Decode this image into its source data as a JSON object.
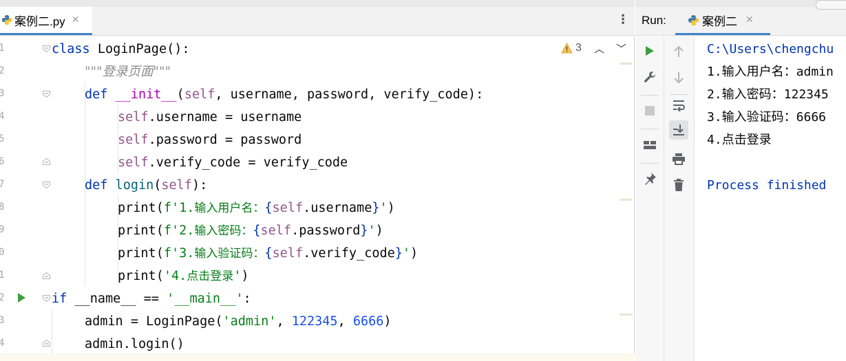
{
  "editor": {
    "tab_label": "案例二.py",
    "tab_close": "✕",
    "menu_icon": "⋮",
    "line_numbers": [
      "1",
      "2",
      "3",
      "4",
      "5",
      "6",
      "7",
      "8",
      "9",
      "0",
      "1",
      "2",
      "3",
      "4"
    ],
    "warning_icon": "warning-triangle-icon",
    "warning_count": "3",
    "nav_up": "︿",
    "nav_down": "﹀",
    "code": {
      "l1_kw": "class",
      "l1_name": " LoginPage",
      "l1_rest": "():",
      "l2_doc": "\"\"\"登录页面\"\"\"",
      "l3_def": "def",
      "l3_sp": " ",
      "l3_init": "__init__",
      "l3_p1": "(",
      "l3_self": "self",
      "l3_rest": ", username, password, verify_code):",
      "l4_self": "self",
      "l4_rest": ".username = username",
      "l5_self": "self",
      "l5_rest": ".password = password",
      "l6_self": "self",
      "l6_rest": ".verify_code = verify_code",
      "l7_def": "def",
      "l7_name": " login",
      "l7_p1": "(",
      "l7_self": "self",
      "l7_rest": "):",
      "l8_print": "print(",
      "l8_f": "f'1.",
      "l8_cn": "输入用户名：",
      "l8_b1": "{",
      "l8_self": "self",
      "l8_attr": ".username",
      "l8_b2": "}",
      "l8_q": "'",
      "l8_end": ")",
      "l9_print": "print(",
      "l9_f": "f'2.",
      "l9_cn": "输入密码：",
      "l9_b1": "{",
      "l9_self": "self",
      "l9_attr": ".password",
      "l9_b2": "}",
      "l9_q": "'",
      "l9_end": ")",
      "l10_print": "print(",
      "l10_f": "f'3.",
      "l10_cn": "输入验证码：",
      "l10_b1": "{",
      "l10_self": "self",
      "l10_attr": ".verify_code",
      "l10_b2": "}",
      "l10_q": "'",
      "l10_end": ")",
      "l11_print": "print(",
      "l11_s1": "'4.",
      "l11_cn": "点击登录",
      "l11_s2": "'",
      "l11_end": ")",
      "l12_if": "if",
      "l12_mid": " __name__ == ",
      "l12_str": "'__main__'",
      "l12_end": ":",
      "l13_a": "admin = LoginPage(",
      "l13_s": "'admin'",
      "l13_c1": ", ",
      "l13_n1": "122345",
      "l13_c2": ", ",
      "l13_n2": "6666",
      "l13_end": ")",
      "l14": "admin.login()"
    }
  },
  "run": {
    "title": "Run:",
    "tab_label": "案例二",
    "tab_close": "✕",
    "toolbar_left": [
      "rerun-icon",
      "wrench-icon",
      "stop-icon",
      "layout-icon",
      "pin-icon"
    ],
    "toolbar_right": [
      "up-arrow-icon",
      "down-arrow-icon",
      "soft-wrap-icon",
      "scroll-to-end-icon",
      "print-icon",
      "trash-icon"
    ],
    "console": [
      "C:\\Users\\chengchu",
      "1.输入用户名：admin",
      "2.输入密码：122345",
      "3.输入验证码：6666",
      "4.点击登录",
      "",
      "Process finished"
    ],
    "colors": {
      "run_green": "#3e9e3e",
      "accent": "#4083c9",
      "console_blue": "#0033b3"
    }
  }
}
